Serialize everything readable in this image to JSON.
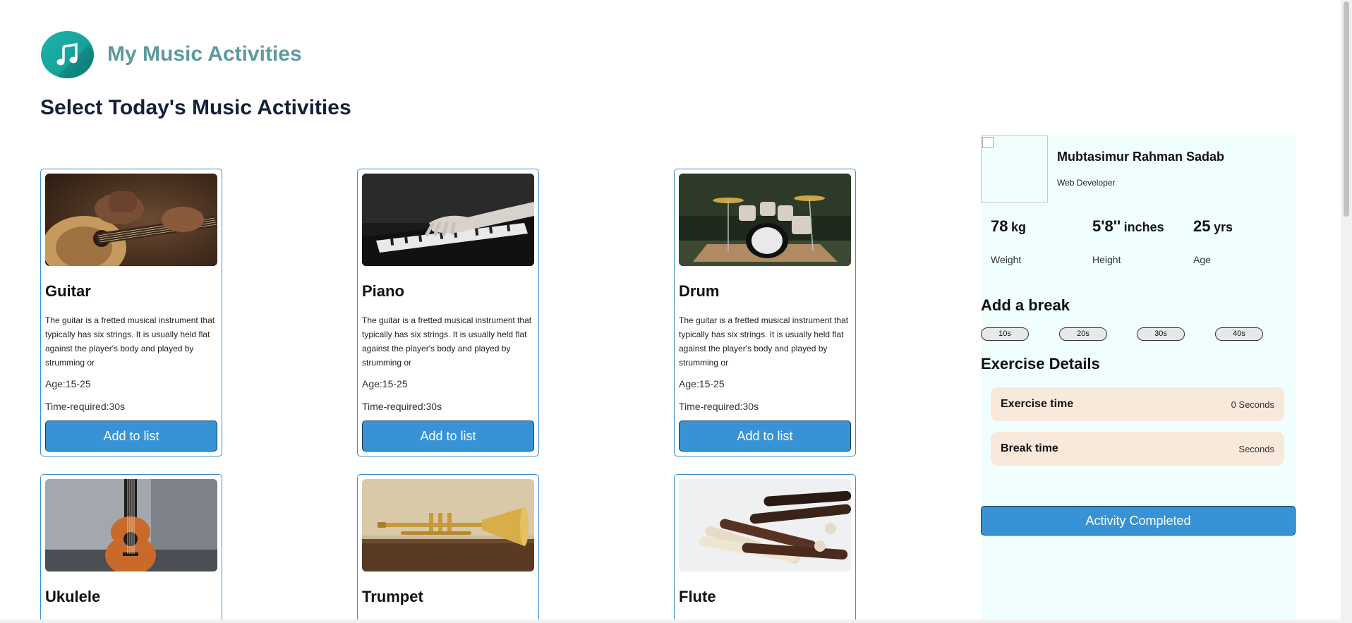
{
  "header": {
    "app_title": "My Music Activities",
    "heading": "Select Today's Music Activities"
  },
  "cards": [
    {
      "title": "Guitar",
      "description": "The guitar is a fretted musical instrument that typically has six strings. It is usually held flat against the player's body and played by strumming or",
      "age": "Age:15-25",
      "time": "Time-required:30s",
      "button": "Add to list"
    },
    {
      "title": "Piano",
      "description": "The guitar is a fretted musical instrument that typically has six strings. It is usually held flat against the player's body and played by strumming or",
      "age": "Age:15-25",
      "time": "Time-required:30s",
      "button": "Add to list"
    },
    {
      "title": "Drum",
      "description": "The guitar is a fretted musical instrument that typically has six strings. It is usually held flat against the player's body and played by strumming or",
      "age": "Age:15-25",
      "time": "Time-required:30s",
      "button": "Add to list"
    },
    {
      "title": "Ukulele"
    },
    {
      "title": "Trumpet"
    },
    {
      "title": "Flute"
    }
  ],
  "profile": {
    "name": "Mubtasimur Rahman Sadab",
    "role": "Web Developer",
    "stats": [
      {
        "value": "78",
        "unit": "kg",
        "label": "Weight"
      },
      {
        "value": "5'8''",
        "unit": "inches",
        "label": "Height"
      },
      {
        "value": "25",
        "unit": "yrs",
        "label": "Age"
      }
    ]
  },
  "breaks": {
    "title": "Add a break",
    "options": [
      "10s",
      "20s",
      "30s",
      "40s"
    ]
  },
  "exercise": {
    "title": "Exercise Details",
    "exercise_time_label": "Exercise time",
    "exercise_time_value": "0 Seconds",
    "break_time_label": "Break time",
    "break_time_value": "Seconds"
  },
  "complete_button": "Activity Completed",
  "colors": {
    "accent": "#3793d6",
    "title_teal": "#5e9a9c",
    "heading_navy": "#13203a",
    "sidebar_bg": "#f1fefe",
    "detail_bg": "#f8e9da"
  }
}
